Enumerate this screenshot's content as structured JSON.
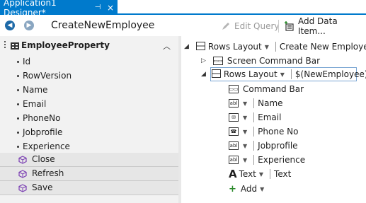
{
  "tab": {
    "title": "Application1 Designer*",
    "pin_icon": "pin-icon",
    "close_icon": "close-icon"
  },
  "toolbar": {
    "screen_name": "CreateNewEmployee",
    "edit_query": "Edit Query",
    "add_data_item": "Add Data Item..."
  },
  "left": {
    "entity": "EmployeeProperty",
    "fields": [
      "Id",
      "RowVersion",
      "Name",
      "Email",
      "PhoneNo",
      "Jobprofile",
      "Experience"
    ],
    "methods": [
      "Close",
      "Refresh",
      "Save"
    ]
  },
  "tree": {
    "root_layout": "Rows Layout",
    "root_title": "Create New Employee",
    "screen_command_bar": "Screen Command Bar",
    "inner_layout": "Rows Layout",
    "inner_binding": "$(NewEmployee)",
    "command_bar": "Command Bar",
    "items": [
      {
        "label": "Name"
      },
      {
        "label": "Email"
      },
      {
        "label": "Phone No"
      },
      {
        "label": "Jobprofile"
      },
      {
        "label": "Experience"
      }
    ],
    "text_control": "Text",
    "text_label": "Text",
    "add": "Add"
  }
}
